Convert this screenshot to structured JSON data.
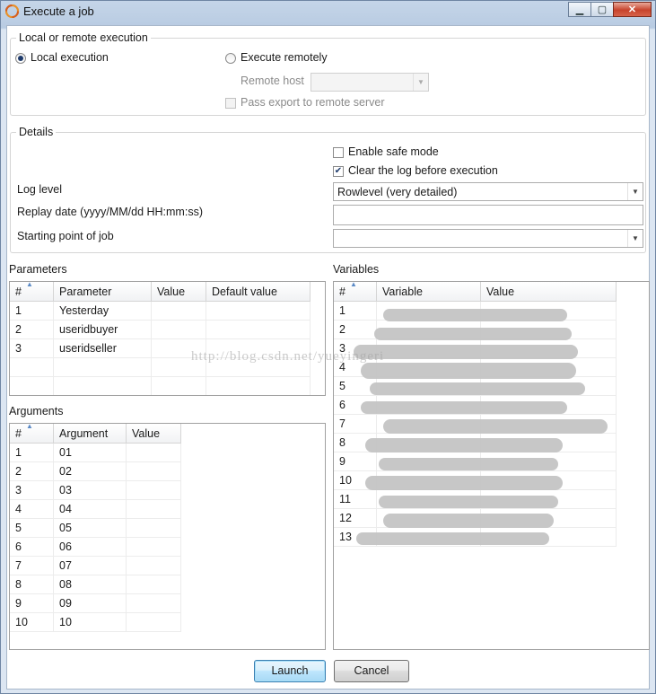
{
  "window": {
    "title": "Execute a job"
  },
  "execution": {
    "legend": "Local or remote execution",
    "local_label": "Local execution",
    "remote_label": "Execute remotely",
    "remote_host_label": "Remote host",
    "remote_host_value": "",
    "pass_export_label": "Pass export to remote server",
    "mode": "local"
  },
  "details": {
    "legend": "Details",
    "safe_mode_label": "Enable safe mode",
    "safe_mode_checked": false,
    "clear_log_label": "Clear the log before execution",
    "clear_log_checked": true,
    "log_level_label": "Log level",
    "log_level_value": "Rowlevel (very detailed)",
    "replay_date_label": "Replay date (yyyy/MM/dd HH:mm:ss)",
    "replay_date_value": "",
    "starting_point_label": "Starting point of job",
    "starting_point_value": ""
  },
  "parameters": {
    "title": "Parameters",
    "columns": [
      "#",
      "Parameter",
      "Value",
      "Default value"
    ],
    "rows": [
      [
        "1",
        "Yesterday",
        "",
        ""
      ],
      [
        "2",
        "useridbuyer",
        "",
        ""
      ],
      [
        "3",
        "useridseller",
        "",
        ""
      ]
    ]
  },
  "arguments": {
    "title": "Arguments",
    "columns": [
      "#",
      "Argument",
      "Value"
    ],
    "rows": [
      [
        "1",
        "01",
        ""
      ],
      [
        "2",
        "02",
        ""
      ],
      [
        "3",
        "03",
        ""
      ],
      [
        "4",
        "04",
        ""
      ],
      [
        "5",
        "05",
        ""
      ],
      [
        "6",
        "06",
        ""
      ],
      [
        "7",
        "07",
        ""
      ],
      [
        "8",
        "08",
        ""
      ],
      [
        "9",
        "09",
        ""
      ],
      [
        "10",
        "10",
        ""
      ]
    ]
  },
  "variables": {
    "title": "Variables",
    "columns": [
      "#",
      "Variable",
      "Value"
    ],
    "rows": [
      "1",
      "2",
      "3",
      "4",
      "5",
      "6",
      "7",
      "8",
      "9",
      "10",
      "11",
      "12",
      "13"
    ]
  },
  "buttons": {
    "launch": "Launch",
    "cancel": "Cancel"
  },
  "watermark": "http://blog.csdn.net/yueyingeri"
}
